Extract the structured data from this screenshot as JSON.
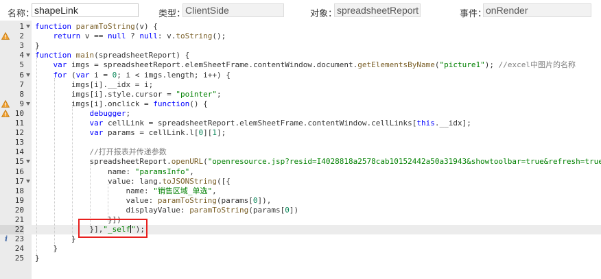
{
  "form": {
    "name_label": "名称：",
    "name_value": "shapeLink",
    "type_label": "类型：",
    "type_value": "ClientSide",
    "object_label": "对象：",
    "object_value": "spreadsheetReport",
    "event_label": "事件：",
    "event_value": "onRender"
  },
  "gutter": {
    "warning_lines": [
      2,
      9,
      10
    ],
    "info_lines": [
      23
    ],
    "fold_lines": [
      1,
      4,
      6,
      9,
      15,
      17
    ],
    "active_line": 22
  },
  "code": {
    "lines": [
      "function paramToString(v) {",
      "    return v == null ? null: v.toString();",
      "}",
      "function main(spreadsheetReport) {",
      "    var imgs = spreadsheetReport.elemSheetFrame.contentWindow.document.getElementsByName(\"picture1\"); //excel中图片的名称",
      "    for (var i = 0; i < imgs.length; i++) {",
      "        imgs[i].__idx = i;",
      "        imgs[i].style.cursor = \"pointer\";",
      "        imgs[i].onclick = function() {",
      "            debugger;",
      "            var cellLink = spreadsheetReport.elemSheetFrame.contentWindow.cellLinks[this.__idx];",
      "            var params = cellLink.l[0][1];",
      "",
      "            //打开报表并传递参数",
      "            spreadsheetReport.openURL(\"openresource.jsp?resid=I4028818a2578cab10152442a50a31943&showtoolbar=true&refresh=true",
      "                name: \"paramsInfo\",",
      "                value: lang.toJSONString([{",
      "                    name: \"销售区域_单选\",",
      "                    value: paramToString(params[0]),",
      "                    displayValue: paramToString(params[0])",
      "                }])",
      "            }],\"_self\");",
      "        }",
      "    }",
      "}"
    ]
  },
  "colors": {
    "keyword": "#0000ff",
    "string": "#008000",
    "comment": "#808080",
    "function": "#795e26",
    "number": "#098658",
    "highlight_box": "#e8201e",
    "gutter_bg": "#ebebeb"
  },
  "icons": {
    "warning": "warning-triangle-icon",
    "info": "info-icon",
    "fold": "fold-arrow-icon"
  }
}
